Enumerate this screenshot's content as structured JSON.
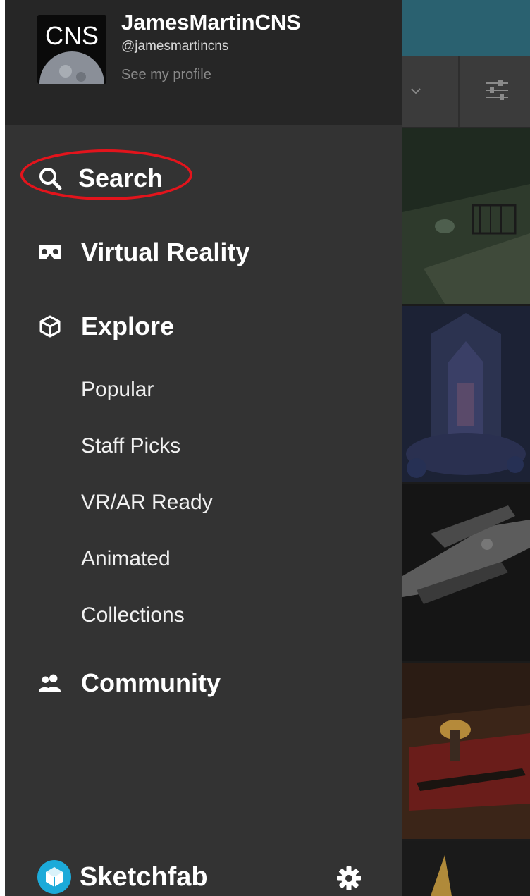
{
  "profile": {
    "avatar_text": "CNS",
    "name": "JamesMartinCNS",
    "handle": "@jamesmartincns",
    "see_profile": "See my profile"
  },
  "nav": {
    "search": {
      "label": "Search",
      "icon": "search-icon"
    },
    "vr": {
      "label": "Virtual Reality",
      "icon": "vr-headset-icon"
    },
    "explore": {
      "label": "Explore",
      "icon": "cube-icon"
    },
    "explore_items": [
      {
        "label": "Popular"
      },
      {
        "label": "Staff Picks"
      },
      {
        "label": "VR/AR Ready"
      },
      {
        "label": "Animated"
      },
      {
        "label": "Collections"
      }
    ],
    "community": {
      "label": "Community",
      "icon": "people-icon"
    }
  },
  "footer": {
    "brand": "Sketchfab",
    "settings_icon": "gear-icon"
  },
  "colors": {
    "drawer_bg": "#333333",
    "header_bg": "#262626",
    "accent_blue": "#1caad9",
    "highlight_red": "#e3141c",
    "topbar_teal": "#2a6170"
  }
}
